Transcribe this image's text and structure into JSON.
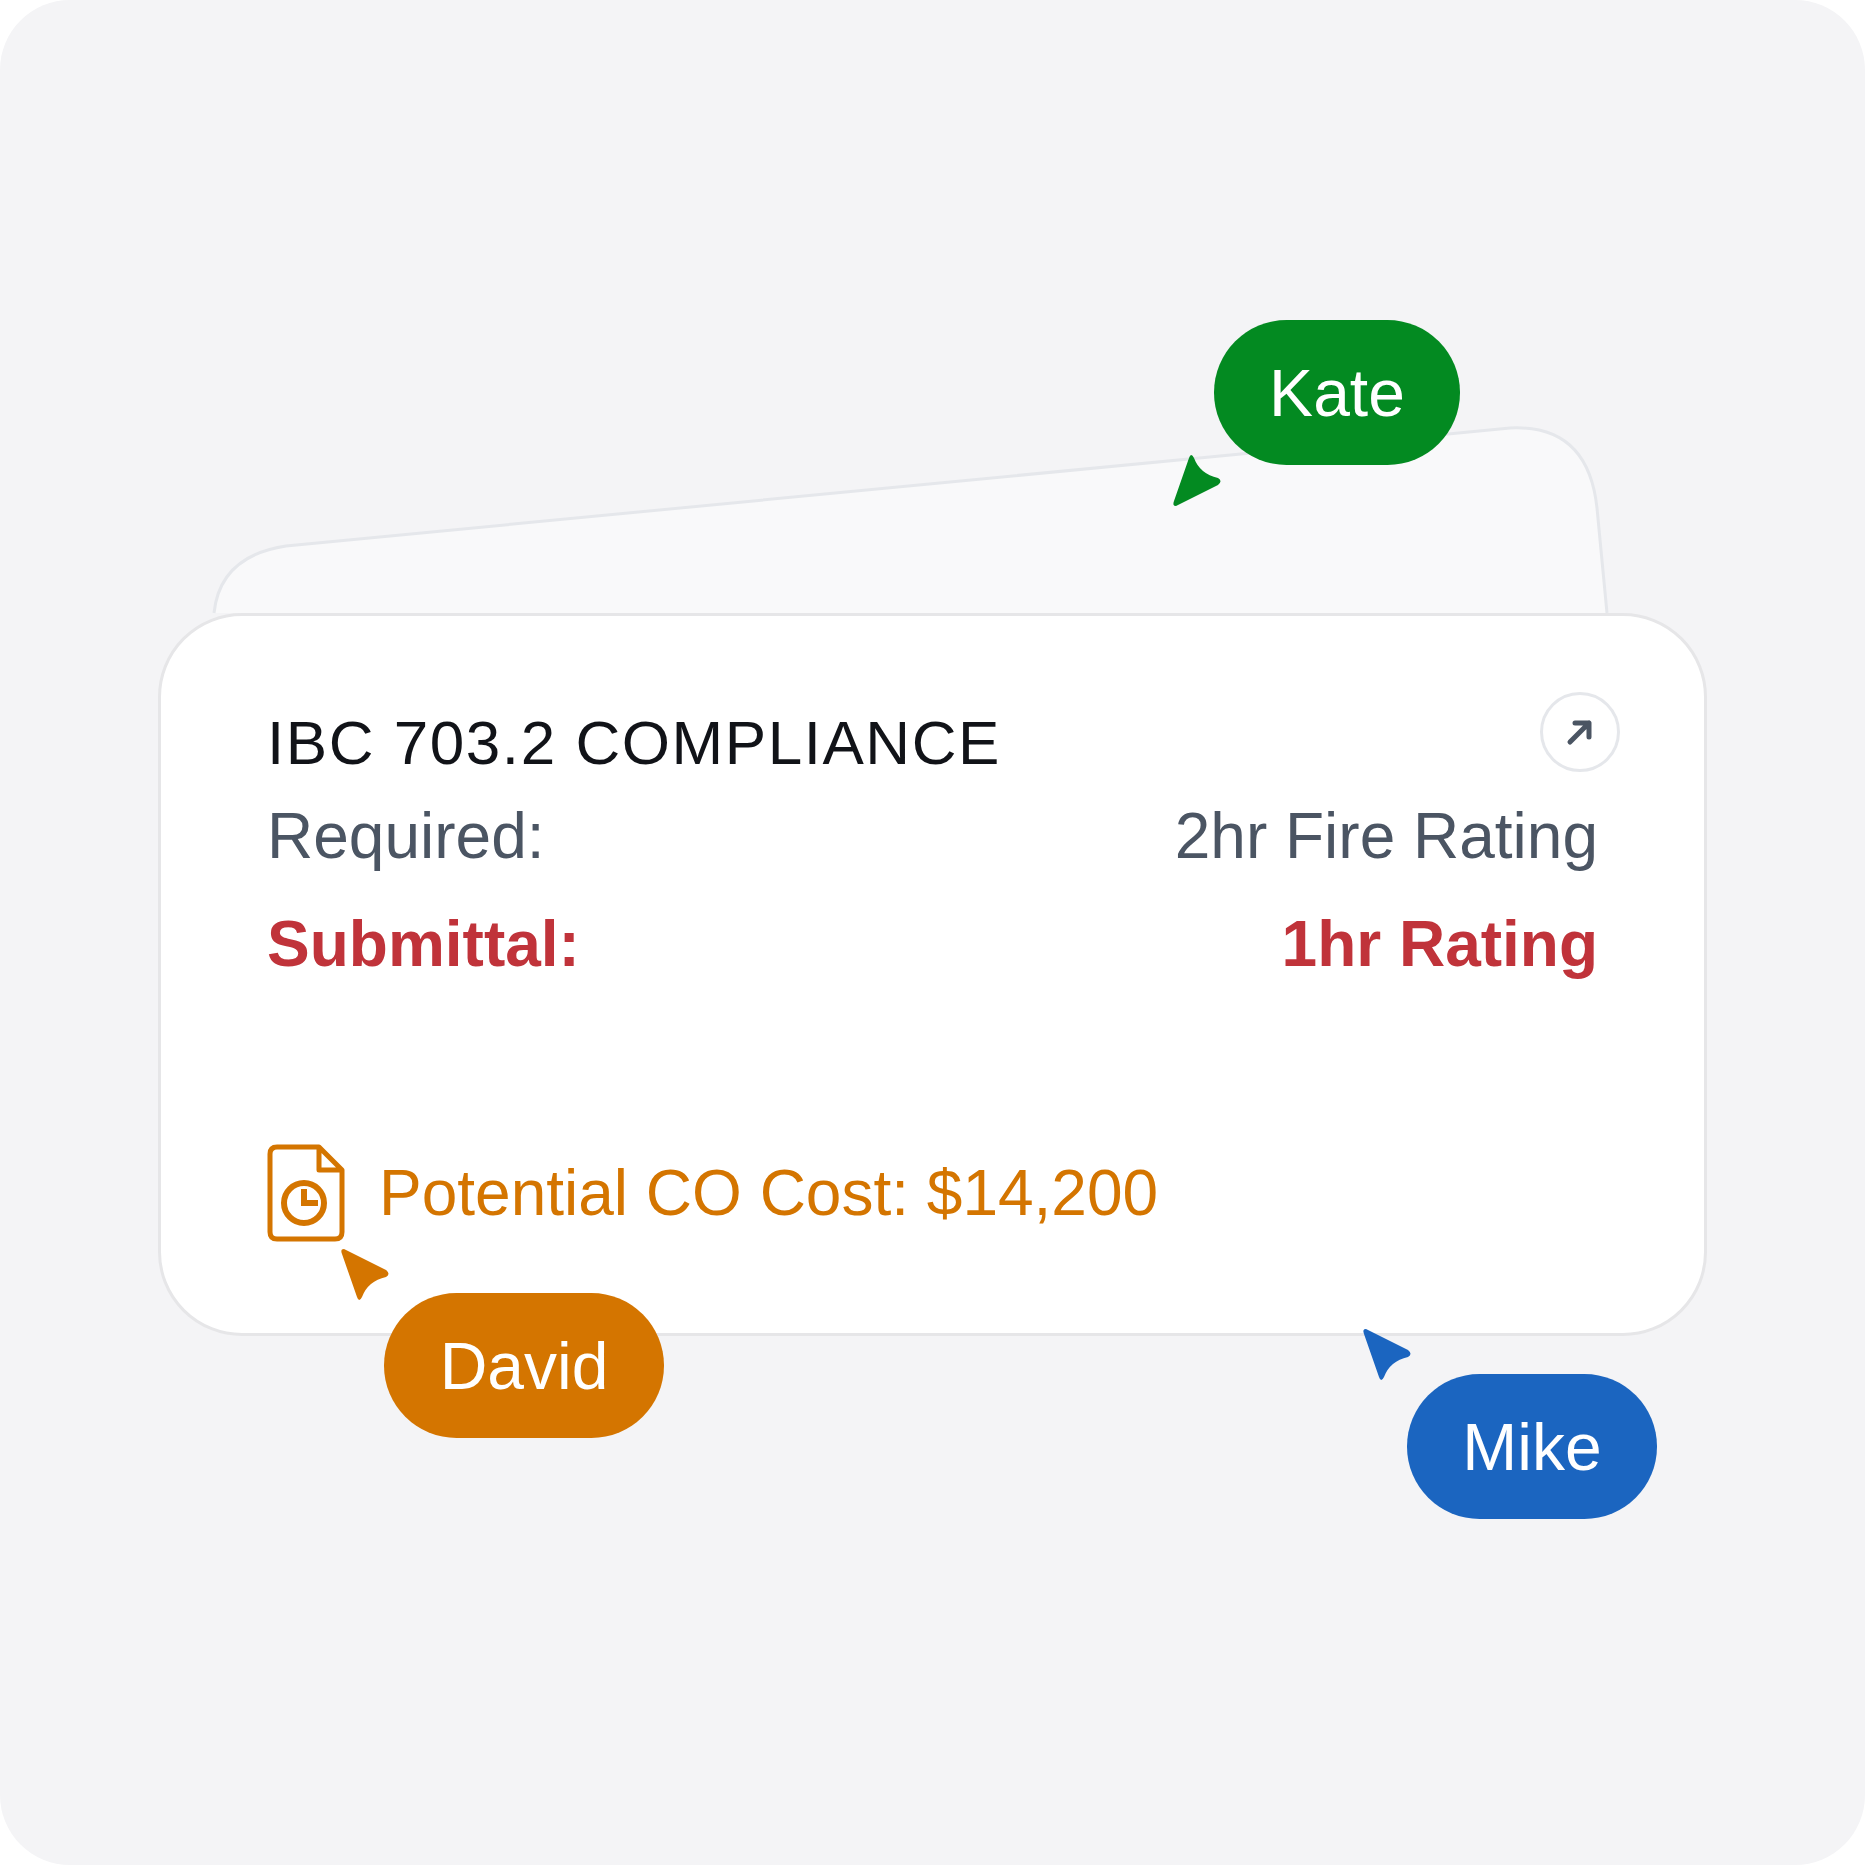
{
  "card": {
    "title": "IBC 703.2 COMPLIANCE",
    "rows": [
      {
        "kind": "required",
        "label": "Required:",
        "value": "2hr Fire Rating"
      },
      {
        "kind": "submittal",
        "label": "Submittal:",
        "value": "1hr Rating"
      }
    ],
    "cost": "Potential CO Cost: $14,200"
  },
  "cursors": [
    {
      "name": "Kate",
      "color": "#038a21"
    },
    {
      "name": "David",
      "color": "#d47500"
    },
    {
      "name": "Mike",
      "color": "#1b65c0"
    }
  ]
}
